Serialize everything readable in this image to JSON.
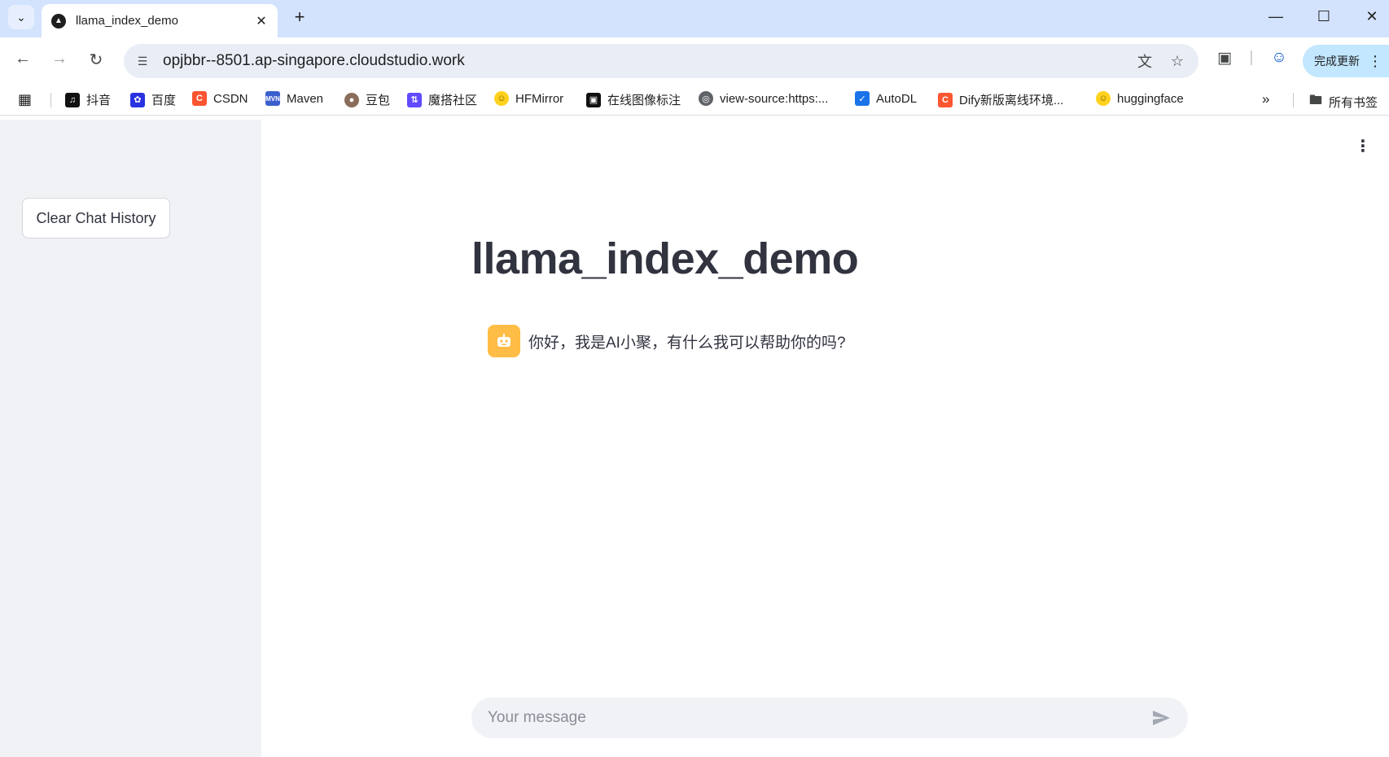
{
  "browser": {
    "tab": {
      "title": "llama_index_demo"
    },
    "new_tab_glyph": "+",
    "url": "opjbbr--8501.ap-singapore.cloudstudio.work",
    "update_label": "完成更新",
    "bookmarks": [
      {
        "label": "抖音",
        "icon": "douyin-icon",
        "color": "#111111"
      },
      {
        "label": "百度",
        "icon": "baidu-icon",
        "color": "#2932e1"
      },
      {
        "label": "CSDN",
        "icon": "csdn-icon",
        "color": "#fc5531"
      },
      {
        "label": "Maven",
        "icon": "maven-icon",
        "color": "#3a5fcd"
      },
      {
        "label": "豆包",
        "icon": "doubao-icon",
        "color": "#8a6d5a"
      },
      {
        "label": "魔搭社区",
        "icon": "modelscope-icon",
        "color": "#624aff"
      },
      {
        "label": "HFMirror",
        "icon": "hf-mirror-icon",
        "color": "#ffd21e"
      },
      {
        "label": "在线图像标注",
        "icon": "annotate-icon",
        "color": "#111111"
      },
      {
        "label": "view-source:https:...",
        "icon": "globe-icon",
        "color": "#5f6368"
      },
      {
        "label": "AutoDL",
        "icon": "autodl-icon",
        "color": "#1a73e8"
      },
      {
        "label": "Dify新版离线环境...",
        "icon": "dify-icon",
        "color": "#fc5531"
      },
      {
        "label": "huggingface",
        "icon": "huggingface-icon",
        "color": "#ffd21e"
      }
    ],
    "all_bookmarks_label": "所有书签"
  },
  "sidebar": {
    "clear_button_label": "Clear Chat History"
  },
  "main": {
    "title": "llama_index_demo",
    "messages": [
      {
        "role": "assistant",
        "text": "你好，我是AI小聚，有什么我可以帮助你的吗?"
      }
    ],
    "input_placeholder": "Your message"
  },
  "colors": {
    "accent": "#ffbd45",
    "tabstrip": "#d3e3fd",
    "sidebar_bg": "#f0f2f6",
    "text": "#31333f"
  }
}
